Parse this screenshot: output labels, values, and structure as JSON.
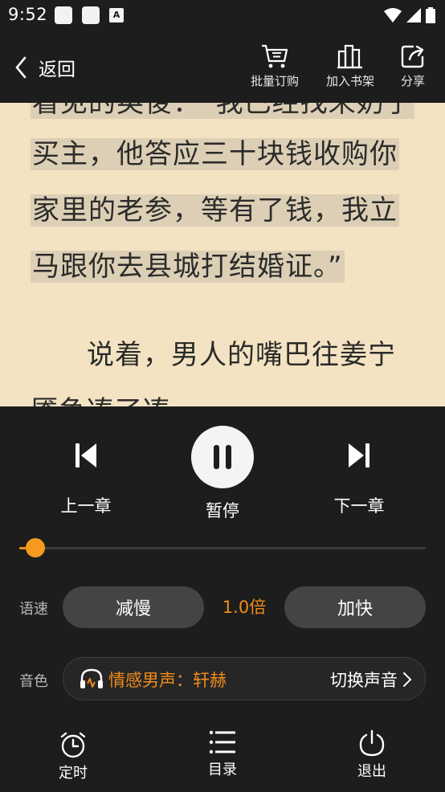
{
  "status_bar": {
    "time": "9:52",
    "notif_a_letter": "A"
  },
  "toolbar": {
    "back_label": "返回",
    "batch_order_label": "批量订购",
    "add_shelf_label": "加入书架",
    "share_label": "分享"
  },
  "reader": {
    "partial_top_line": "看见的英俊：“我已经找来奶子",
    "lines": [
      "买主，他答应三十块钱收购你",
      "家里的老参，等有了钱，我立",
      "马跟你去县城打结婚证。”",
      "说着，男人的嘴巴往姜宁",
      "靥争凑了凑"
    ]
  },
  "player": {
    "prev_label": "上一章",
    "pause_label": "暂停",
    "next_label": "下一章",
    "progress": 0.04,
    "speed_row_label": "语速",
    "slower_label": "减慢",
    "speed_value": "1.0倍",
    "faster_label": "加快",
    "voice_row_label": "音色",
    "voice_name": "情感男声：轩赫",
    "switch_voice_label": "切换声音",
    "timer_label": "定时",
    "catalog_label": "目录",
    "exit_label": "退出"
  },
  "colors": {
    "accent": "#f28c1a",
    "panel_bg": "#1d1d1d",
    "page_bg": "#f3e3c2",
    "highlight": "#dccfb5"
  }
}
